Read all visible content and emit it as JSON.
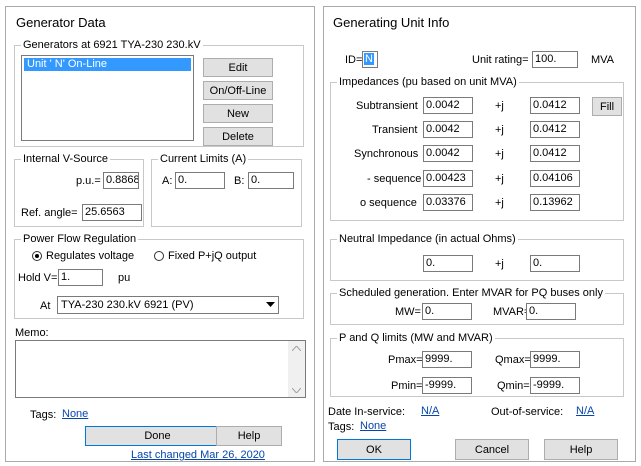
{
  "left": {
    "title": "Generator Data",
    "gen_group_label": "Generators at 6921 TYA-230      230.kV",
    "gen_list_item": "Unit ' N'  On-Line",
    "edit_btn": "Edit",
    "onoff_btn": "On/Off-Line",
    "new_btn": "New",
    "delete_btn": "Delete",
    "vsource_label": "Internal V-Source",
    "pu_label": "p.u.=",
    "pu_value": "0.88683",
    "refangle_label": "Ref. angle=",
    "refangle_value": "25.6563",
    "curlim_label": "Current Limits (A)",
    "a_label": "A:",
    "a_value": "0.",
    "b_label": "B:",
    "b_value": "0.",
    "pfr_label": "Power Flow Regulation",
    "reg_voltage": "Regulates voltage",
    "fixed_pq": "Fixed P+jQ output",
    "holdv_label": "Hold V=",
    "holdv_value": "1.",
    "pu_unit": "pu",
    "at_label": "At",
    "at_value": "TYA-230      230.kV  6921 (PV)",
    "memo_label": "Memo:",
    "tags_label": "Tags:",
    "tags_link": "None",
    "done_btn": "Done",
    "help_btn": "Help",
    "last_changed": "Last changed Mar 26, 2020"
  },
  "right": {
    "title": "Generating Unit Info",
    "id_label": "ID=",
    "id_value": "N",
    "rating_label": "Unit rating=",
    "rating_value": "100.",
    "mva_unit": "MVA",
    "imp_label": "Impedances (pu based on unit MVA)",
    "rows": [
      {
        "label": "Subtransient",
        "re": "0.0042",
        "j": "+j",
        "im": "0.0412"
      },
      {
        "label": "Transient",
        "re": "0.0042",
        "j": "+j",
        "im": "0.0412"
      },
      {
        "label": "Synchronous",
        "re": "0.0042",
        "j": "+j",
        "im": "0.0412"
      },
      {
        "label": "- sequence",
        "re": "0.00423",
        "j": "+j",
        "im": "0.04106"
      },
      {
        "label": "o sequence",
        "re": "0.03376",
        "j": "+j",
        "im": "0.13962"
      }
    ],
    "fill_btn": "Fill",
    "neutral_label": "Neutral Impedance (in actual Ohms)",
    "neutral_re": "0.",
    "neutral_j": "+j",
    "neutral_im": "0.",
    "sched_label": "Scheduled generation. Enter MVAR for PQ buses only",
    "mw_label": "MW=",
    "mw_value": "0.",
    "mvar_label": "MVAR=",
    "mvar_value": "0.",
    "pq_label": "P and Q limits (MW and MVAR)",
    "pmax_label": "Pmax=",
    "pmax_value": "9999.",
    "qmax_label": "Qmax=",
    "qmax_value": "9999.",
    "pmin_label": "Pmin=",
    "pmin_value": "-9999.",
    "qmin_label": "Qmin=",
    "qmin_value": "-9999.",
    "date_in_label": "Date In-service:",
    "date_in_link": "N/A",
    "oos_label": "Out-of-service:",
    "oos_link": "N/A",
    "tags_label": "Tags:",
    "tags_link": "None",
    "ok_btn": "OK",
    "cancel_btn": "Cancel",
    "help_btn": "Help"
  }
}
